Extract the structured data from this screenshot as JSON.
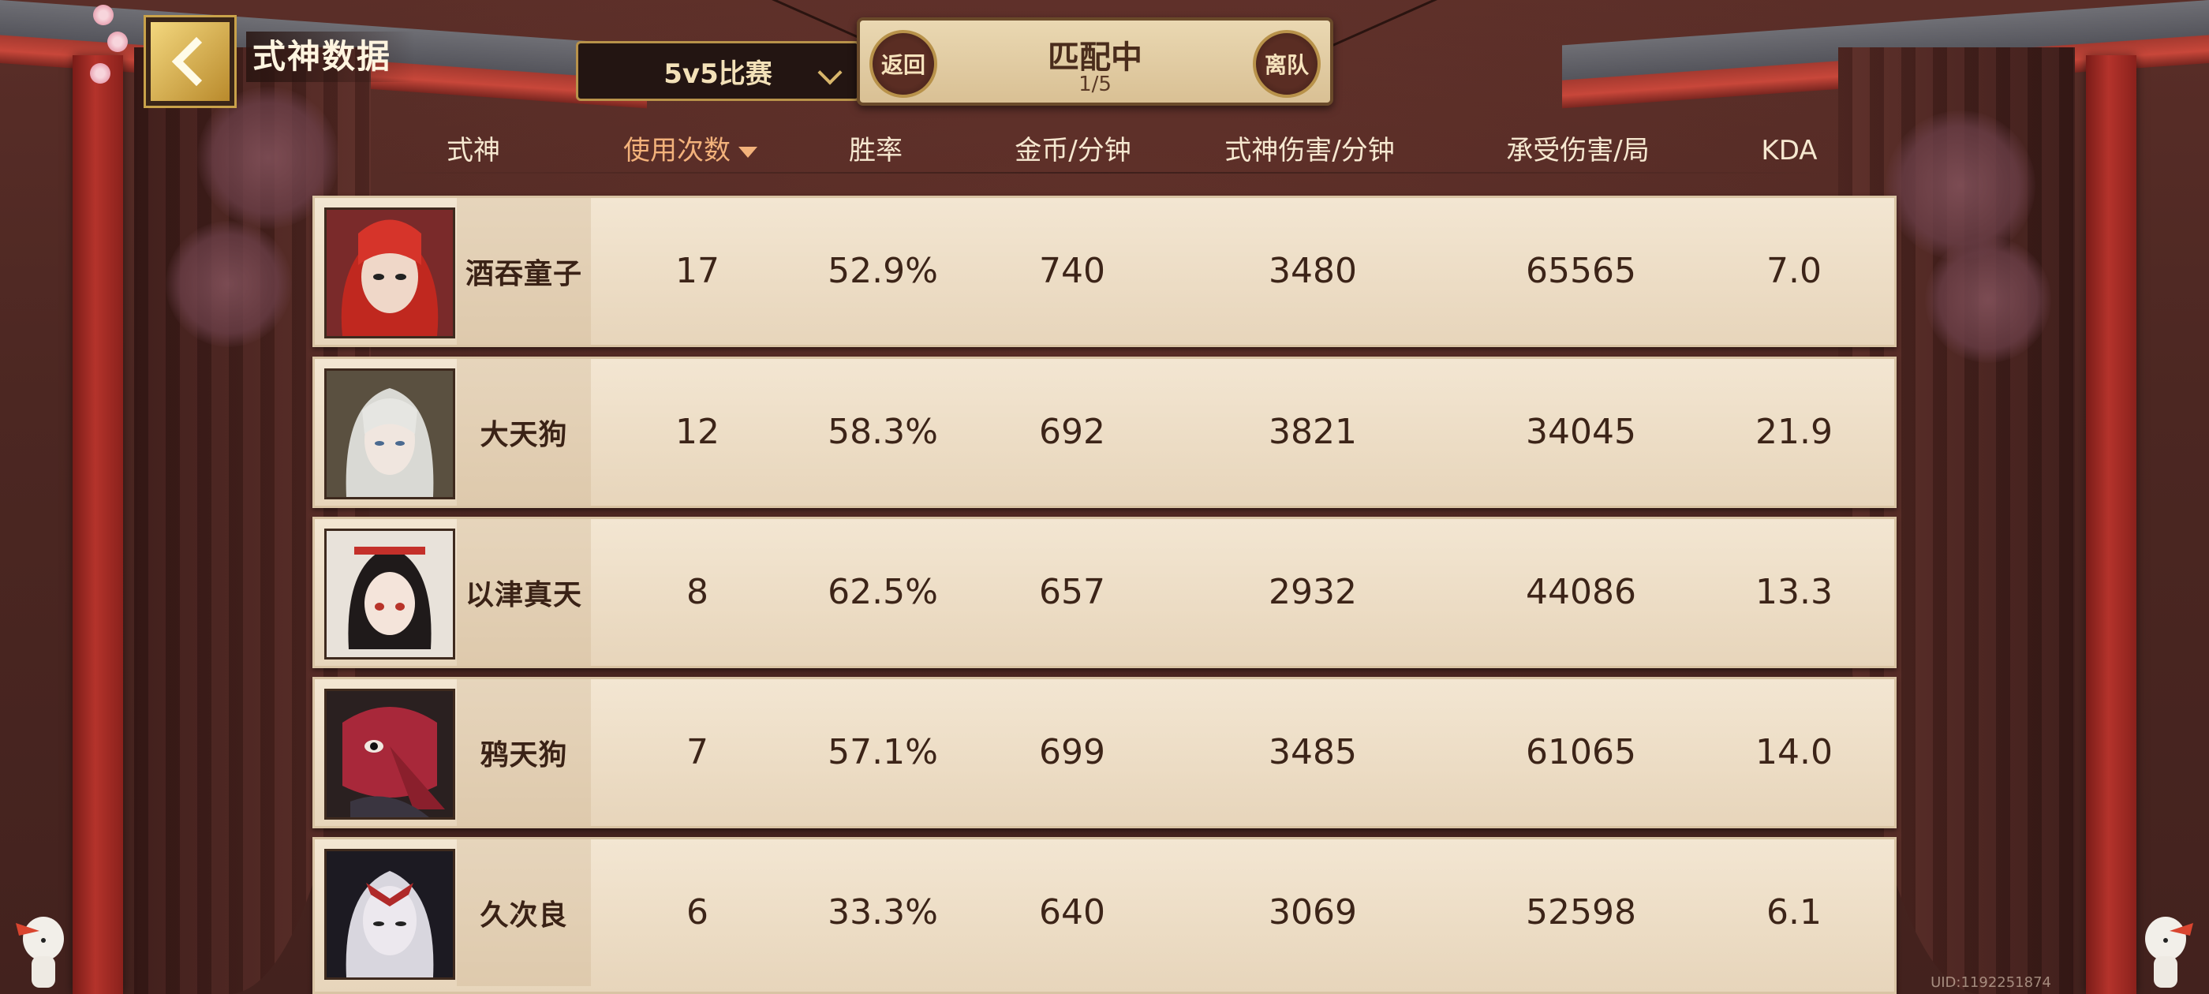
{
  "header": {
    "title": "式神数据",
    "mode_label": "5v5比赛",
    "match_status": "匹配中",
    "match_count": "1/5",
    "back_label": "返回",
    "leave_label": "离队"
  },
  "columns": [
    "式神",
    "使用次数",
    "胜率",
    "金币/分钟",
    "式神伤害/分钟",
    "承受伤害/局",
    "KDA"
  ],
  "sorted_column": "使用次数",
  "rows": [
    {
      "name": "酒吞童子",
      "uses": "17",
      "win_rate": "52.9%",
      "gold_per_min": "740",
      "damage_per_min": "3480",
      "damage_taken": "65565",
      "kda": "7.0"
    },
    {
      "name": "大天狗",
      "uses": "12",
      "win_rate": "58.3%",
      "gold_per_min": "692",
      "damage_per_min": "3821",
      "damage_taken": "34045",
      "kda": "21.9"
    },
    {
      "name": "以津真天",
      "uses": "8",
      "win_rate": "62.5%",
      "gold_per_min": "657",
      "damage_per_min": "2932",
      "damage_taken": "44086",
      "kda": "13.3"
    },
    {
      "name": "鸦天狗",
      "uses": "7",
      "win_rate": "57.1%",
      "gold_per_min": "699",
      "damage_per_min": "3485",
      "damage_taken": "61065",
      "kda": "14.0"
    },
    {
      "name": "久次良",
      "uses": "6",
      "win_rate": "33.3%",
      "gold_per_min": "640",
      "damage_per_min": "3069",
      "damage_taken": "52598",
      "kda": "6.1"
    }
  ],
  "uid": "UID:1192251874",
  "colors": {
    "accent_sort": "#f3b27b",
    "gold_border": "#b8924a",
    "row_bg": "#f0e2cc"
  }
}
